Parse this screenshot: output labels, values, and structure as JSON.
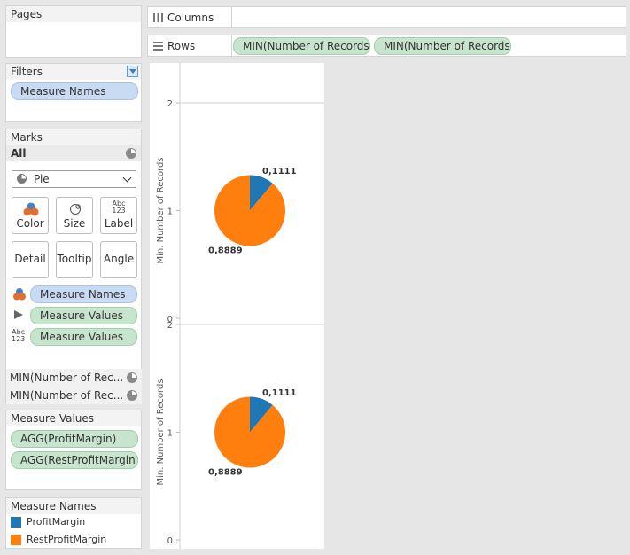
{
  "pages": {
    "title": "Pages"
  },
  "filters": {
    "title": "Filters",
    "pills": [
      "Measure Names"
    ]
  },
  "marks": {
    "title": "Marks",
    "all_label": "All",
    "mark_type": "Pie",
    "buttons": [
      "Color",
      "Size",
      "Label",
      "Detail",
      "Tooltip",
      "Angle"
    ],
    "label_icon_text": "Abc\n123",
    "encodings": [
      {
        "icon": "color-icon",
        "pill": "Measure Names",
        "kind": "blue"
      },
      {
        "icon": "angle-icon",
        "pill": "Measure Values",
        "kind": "green"
      },
      {
        "icon": "label-icon",
        "pill": "Measure Values",
        "kind": "green"
      }
    ],
    "sub_cards": [
      "MIN(Number of Rec...",
      "MIN(Number of Rec..."
    ]
  },
  "measure_values": {
    "title": "Measure Values",
    "pills": [
      "AGG(ProfitMargin)",
      "AGG(RestProfitMargin)"
    ]
  },
  "measure_names": {
    "title": "Measure Names",
    "items": [
      {
        "label": "ProfitMargin",
        "color": "#1f77b4"
      },
      {
        "label": "RestProfitMargin",
        "color": "#ff7f0e"
      }
    ]
  },
  "columns": {
    "label": "Columns"
  },
  "rows": {
    "label": "Rows",
    "pills": [
      "MIN(Number of Records)",
      "MIN(Number of Records)"
    ]
  },
  "chart_data": [
    {
      "type": "pie",
      "ylabel": "Min. Number of Records",
      "y_ticks": [
        "2",
        "1",
        "0"
      ],
      "slices": [
        {
          "name": "ProfitMargin",
          "value": 0.1111,
          "label": "0,1111",
          "color": "#1f77b4"
        },
        {
          "name": "RestProfitMargin",
          "value": 0.8889,
          "label": "0,8889",
          "color": "#ff7f0e"
        }
      ]
    },
    {
      "type": "pie",
      "ylabel": "Min. Number of Records",
      "y_ticks": [
        "2",
        "1",
        "0"
      ],
      "slices": [
        {
          "name": "ProfitMargin",
          "value": 0.1111,
          "label": "0,1111",
          "color": "#1f77b4"
        },
        {
          "name": "RestProfitMargin",
          "value": 0.8889,
          "label": "0,8889",
          "color": "#ff7f0e"
        }
      ]
    }
  ]
}
